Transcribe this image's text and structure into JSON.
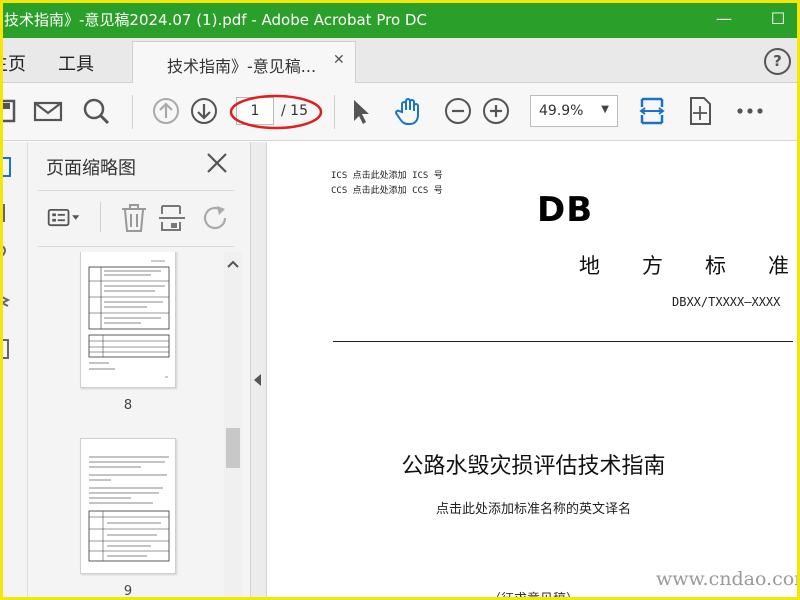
{
  "window": {
    "title": "技术指南》-意见稿2024.07 (1).pdf - Adobe Acrobat Pro DC",
    "minimize_symbol": "—",
    "maximize_symbol": "☐"
  },
  "tabs": {
    "home": "主页",
    "tools": "工具",
    "document": "技术指南》-意见稿...",
    "close_symbol": "✕",
    "help_symbol": "?"
  },
  "toolbar": {
    "current_page": "1",
    "total_pages": "/ 15",
    "zoom": "49.9%",
    "zoom_arrow": "▼",
    "icons": [
      "save-icon",
      "email-icon",
      "search-icon",
      "previous-page-icon",
      "next-page-icon",
      "select-cursor-icon",
      "hand-tool-icon",
      "zoom-out-icon",
      "zoom-in-icon",
      "fit-width-icon",
      "scroll-mode-icon",
      "more-icon"
    ],
    "annotation_color": "#e02020"
  },
  "thumbnail_panel": {
    "title": "页面缩略图",
    "pages": [
      {
        "label": "8"
      },
      {
        "label": "9"
      }
    ]
  },
  "document": {
    "ics_line": "ICS  点击此处添加 ICS 号",
    "ccs_line": "CCS  点击此处添加 CCS 号",
    "logo": "DB",
    "standard_type_chars": [
      "地",
      "方",
      "标",
      "准"
    ],
    "standard_code": "DBXX/TXXXX—XXXX",
    "title": "公路水毁灾损评估技术指南",
    "english_title_placeholder": "点击此处添加标准名称的英文译名",
    "draft_note": "（征求意见稿）"
  },
  "watermark": "www.cndao.com",
  "colors": {
    "titlebar": "#2aa02a",
    "accent_blue": "#1a73c8",
    "frame": "#f5e60a"
  }
}
